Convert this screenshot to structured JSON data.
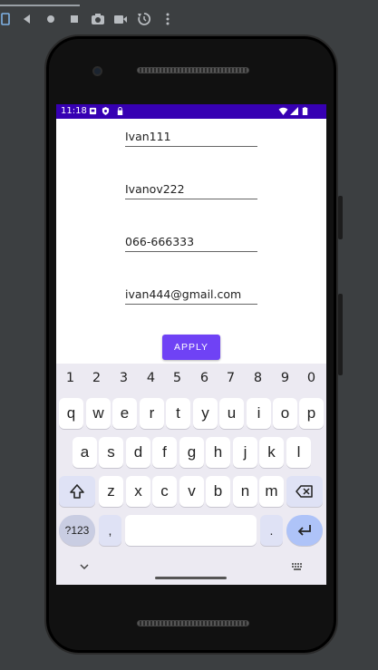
{
  "toolbar": {
    "icons": [
      "device-frame-icon",
      "back-icon",
      "home-icon",
      "overview-icon",
      "camera-icon",
      "video-icon",
      "rotate-icon",
      "more-icon"
    ]
  },
  "status_bar": {
    "time": "11:18",
    "icons": [
      "notification-icon",
      "shield-icon",
      "lock-icon",
      "wifi-icon",
      "signal-icon",
      "battery-icon"
    ]
  },
  "form": {
    "first_name": "Ivan111",
    "last_name": "Ivanov222",
    "phone": "066-666333",
    "email": "ivan444@gmail.com",
    "apply_label": "APPLY"
  },
  "keyboard": {
    "numbers": [
      "1",
      "2",
      "3",
      "4",
      "5",
      "6",
      "7",
      "8",
      "9",
      "0"
    ],
    "row1": [
      "q",
      "w",
      "e",
      "r",
      "t",
      "y",
      "u",
      "i",
      "o",
      "p"
    ],
    "row2": [
      "a",
      "s",
      "d",
      "f",
      "g",
      "h",
      "j",
      "k",
      "l"
    ],
    "row3": [
      "z",
      "x",
      "c",
      "v",
      "b",
      "n",
      "m"
    ],
    "symbols_label": "?123",
    "comma_label": ",",
    "period_label": ".",
    "shift_icon": "shift-icon",
    "backspace_icon": "backspace-icon",
    "enter_icon": "enter-icon",
    "hide_icon": "chevron-down-icon",
    "keyboard_icon": "keyboard-icon"
  },
  "colors": {
    "status_bar": "#3700b3",
    "button": "#6f42f5",
    "enter_key": "#aec3f8",
    "mod_key": "#dfe2f5"
  }
}
